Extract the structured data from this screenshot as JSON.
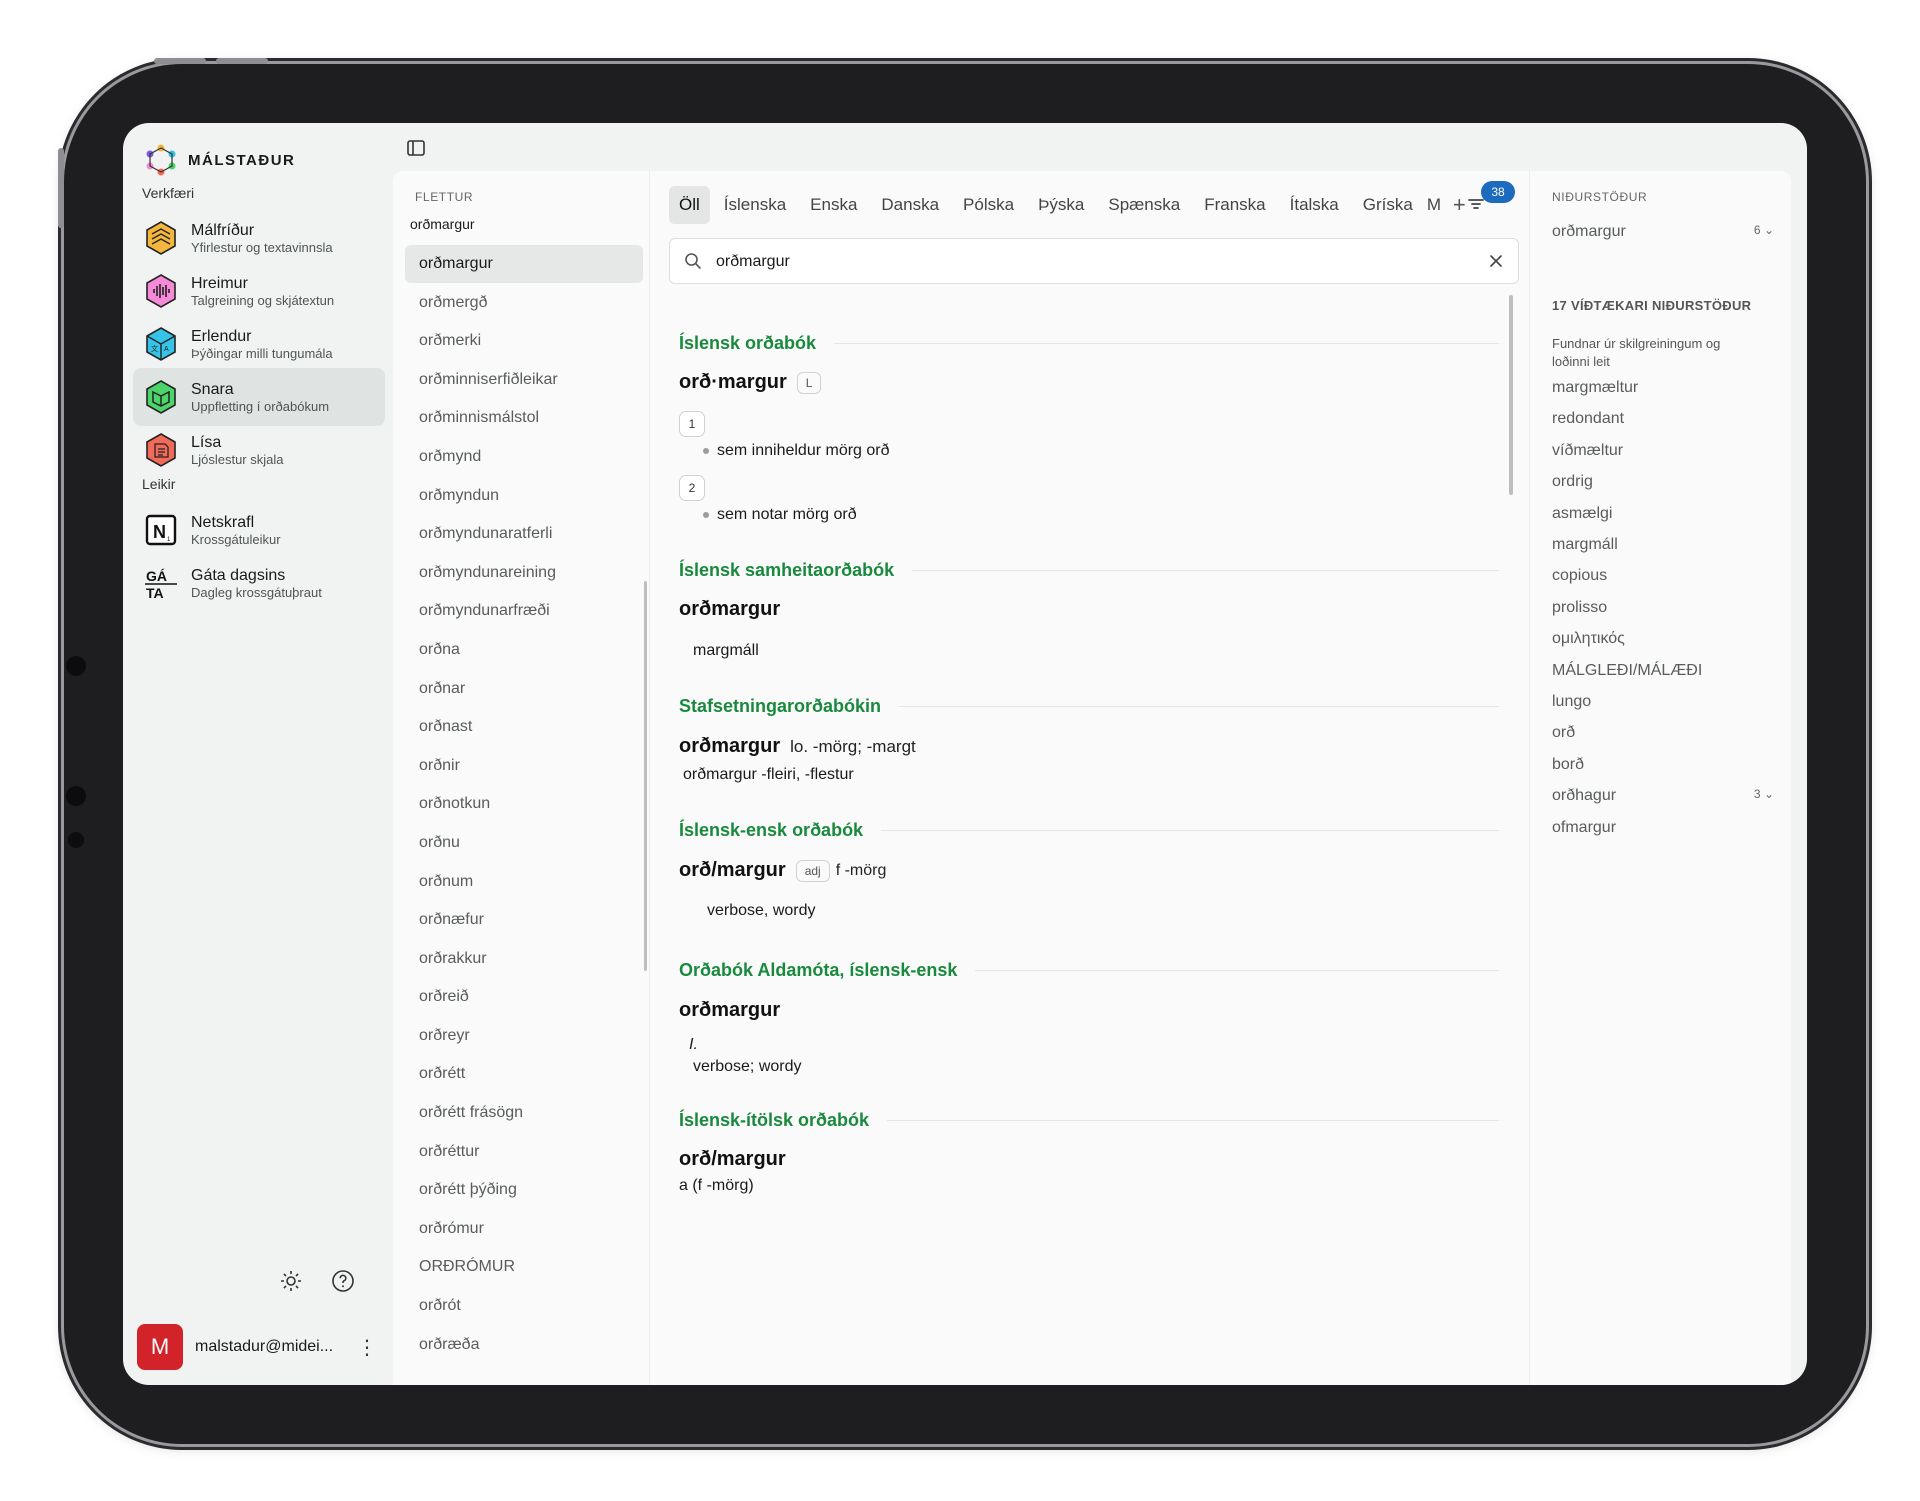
{
  "app": {
    "logo_text": "MÁLSTAÐUR"
  },
  "sidebar": {
    "tools_heading": "Verkfæri",
    "tools": [
      {
        "name": "Málfríður",
        "sub": "Yfirlestur og textavinnsla",
        "icon": "hex-grid-icon",
        "color": "#f4b63c"
      },
      {
        "name": "Hreimur",
        "sub": "Talgreining og skjátextun",
        "icon": "waveform-icon",
        "color": "#f58ad8"
      },
      {
        "name": "Erlendur",
        "sub": "Þýðingar milli tungumála",
        "icon": "translate-icon",
        "color": "#35c3e8"
      },
      {
        "name": "Snara",
        "sub": "Uppfletting í orðabókum",
        "icon": "book-icon",
        "color": "#4cd36a"
      },
      {
        "name": "Lísa",
        "sub": "Ljóslestur skjala",
        "icon": "document-scan-icon",
        "color": "#f26a5a"
      }
    ],
    "games_heading": "Leikir",
    "games": [
      {
        "name": "Netskrafl",
        "sub": "Krossgátuleikur",
        "icon": "n-tile-icon"
      },
      {
        "name": "Gáta dagsins",
        "sub": "Dagleg krossgátuþraut",
        "icon": "gata-icon",
        "glyph_top": "GÁ",
        "glyph_bottom": "TA"
      }
    ],
    "user": {
      "initial": "M",
      "email": "malstadur@midei..."
    }
  },
  "wordlist": {
    "label": "FLETTUR",
    "query": "orðmargur",
    "items": [
      "orðmargur",
      "orðmergð",
      "orðmerki",
      "orðminniserfiðleikar",
      "orðminnismálstol",
      "orðmynd",
      "orðmyndun",
      "orðmyndunaratferli",
      "orðmyndunareining",
      "orðmyndunarfræði",
      "orðna",
      "orðnar",
      "orðnast",
      "orðnir",
      "orðnotkun",
      "orðnu",
      "orðnum",
      "orðnæfur",
      "orðrakkur",
      "orðreið",
      "orðreyr",
      "orðrétt",
      "orðrétt frásögn",
      "orðréttur",
      "orðrétt þýðing",
      "orðrómur",
      "ORÐRÓMUR",
      "orðrót",
      "orðræða"
    ]
  },
  "results": {
    "tabs": [
      "Öll",
      "Íslenska",
      "Enska",
      "Danska",
      "Pólska",
      "Þýska",
      "Spænska",
      "Franska",
      "Ítalska",
      "Gríska"
    ],
    "tab_overflow": "M",
    "add_tab": "+",
    "filter_count": "38",
    "search": {
      "value": "orðmargur",
      "placeholder": ""
    },
    "sections": {
      "s1": {
        "title": "Íslensk orðabók",
        "headword": "orð·margur",
        "tag": "L",
        "senses": [
          {
            "num": "1",
            "text": "sem inniheldur mörg orð"
          },
          {
            "num": "2",
            "text": "sem notar mörg orð"
          }
        ]
      },
      "s2": {
        "title": "Íslensk samheitaorðabók",
        "headword": "orðmargur",
        "text": "margmáll"
      },
      "s3": {
        "title": "Stafsetningarorðabókin",
        "headword": "orðmargur",
        "gram": "lo. -mörg; -margt",
        "text": "orðmargur -fleiri, -flestur"
      },
      "s4": {
        "title": "Íslensk-ensk orðabók",
        "headword": "orð/margur",
        "tag": "adj",
        "gram": "f -mörg",
        "text": "verbose, wordy"
      },
      "s5": {
        "title": "Orðabók Aldamóta, íslensk-ensk",
        "headword": "orðmargur",
        "roman": "I.",
        "text": "verbose; wordy"
      },
      "s6": {
        "title": "Íslensk-ítölsk orðabók",
        "headword": "orð/margur",
        "text": "a (f -mörg)"
      }
    }
  },
  "right": {
    "label": "NIÐURSTÖÐUR",
    "top": {
      "word": "orðmargur",
      "count": "6"
    },
    "more_heading": "17 VÍÐTÆKARI NIÐURSTÖÐUR",
    "more_desc": "Fundnar úr skilgreiningum og loðinni leit",
    "items": [
      "margmæltur",
      "redondant",
      "víðmæltur",
      "ordrig",
      "asmælgi",
      "margmáll",
      "copious",
      "prolisso",
      "ομιλητικός",
      "MÁLGLEÐI/MÁLÆÐI",
      "lungo",
      "orð",
      "borð"
    ],
    "item_with_count": {
      "word": "orðhagur",
      "count": "3"
    },
    "last_item": "ofmargur"
  }
}
